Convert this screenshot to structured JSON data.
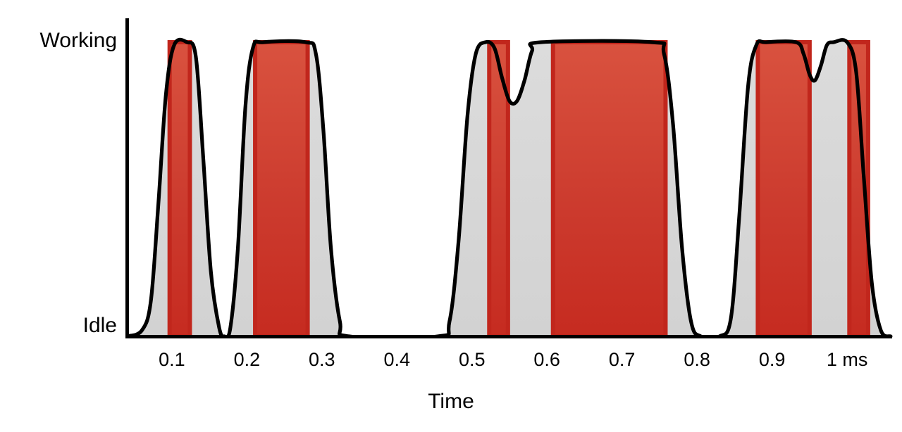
{
  "chart_data": {
    "type": "area",
    "title": "",
    "xlabel": "Time",
    "ylabel": "",
    "x_tick_labels": [
      "0.1",
      "0.2",
      "0.3",
      "0.4",
      "0.5",
      "0.6",
      "0.7",
      "0.8",
      "0.9",
      "1 ms"
    ],
    "x_tick_values": [
      0.1,
      0.2,
      0.3,
      0.4,
      0.5,
      0.6,
      0.7,
      0.8,
      0.9,
      1.0
    ],
    "xlim": [
      0.04,
      1.06
    ],
    "y_tick_labels": [
      "Working",
      "Idle"
    ],
    "y_tick_values": [
      1,
      0
    ],
    "ylim": [
      0,
      1
    ],
    "grid": false,
    "legend": null,
    "axis_lines": [
      "left",
      "bottom"
    ],
    "series": [
      {
        "name": "activity-envelope",
        "role": "smooth-envelope-curve",
        "fill_color": "#D6D6D6",
        "line_color": "#000000",
        "description": "Smooth envelope of processor activity rising from Idle to Working across five bursts",
        "points": [
          {
            "t": 0.04,
            "v": 0.0
          },
          {
            "t": 0.06,
            "v": 0.02
          },
          {
            "t": 0.072,
            "v": 0.12
          },
          {
            "t": 0.082,
            "v": 0.45
          },
          {
            "t": 0.092,
            "v": 0.82
          },
          {
            "t": 0.103,
            "v": 0.99
          },
          {
            "t": 0.12,
            "v": 1.0
          },
          {
            "t": 0.132,
            "v": 0.95
          },
          {
            "t": 0.142,
            "v": 0.6
          },
          {
            "t": 0.152,
            "v": 0.22
          },
          {
            "t": 0.163,
            "v": 0.03
          },
          {
            "t": 0.17,
            "v": 0.0
          },
          {
            "t": 0.178,
            "v": 0.03
          },
          {
            "t": 0.188,
            "v": 0.3
          },
          {
            "t": 0.198,
            "v": 0.78
          },
          {
            "t": 0.208,
            "v": 0.98
          },
          {
            "t": 0.222,
            "v": 1.0
          },
          {
            "t": 0.278,
            "v": 1.0
          },
          {
            "t": 0.292,
            "v": 0.96
          },
          {
            "t": 0.302,
            "v": 0.7
          },
          {
            "t": 0.312,
            "v": 0.3
          },
          {
            "t": 0.324,
            "v": 0.05
          },
          {
            "t": 0.336,
            "v": 0.0
          },
          {
            "t": 0.455,
            "v": 0.0
          },
          {
            "t": 0.47,
            "v": 0.05
          },
          {
            "t": 0.482,
            "v": 0.32
          },
          {
            "t": 0.494,
            "v": 0.75
          },
          {
            "t": 0.505,
            "v": 0.96
          },
          {
            "t": 0.518,
            "v": 1.0
          },
          {
            "t": 0.53,
            "v": 0.98
          },
          {
            "t": 0.54,
            "v": 0.88
          },
          {
            "t": 0.55,
            "v": 0.8
          },
          {
            "t": 0.56,
            "v": 0.8
          },
          {
            "t": 0.57,
            "v": 0.87
          },
          {
            "t": 0.58,
            "v": 0.97
          },
          {
            "t": 0.592,
            "v": 1.0
          },
          {
            "t": 0.74,
            "v": 1.0
          },
          {
            "t": 0.756,
            "v": 0.96
          },
          {
            "t": 0.768,
            "v": 0.72
          },
          {
            "t": 0.78,
            "v": 0.3
          },
          {
            "t": 0.792,
            "v": 0.05
          },
          {
            "t": 0.805,
            "v": 0.0
          },
          {
            "t": 0.83,
            "v": 0.0
          },
          {
            "t": 0.845,
            "v": 0.06
          },
          {
            "t": 0.856,
            "v": 0.4
          },
          {
            "t": 0.868,
            "v": 0.85
          },
          {
            "t": 0.879,
            "v": 0.99
          },
          {
            "t": 0.892,
            "v": 1.0
          },
          {
            "t": 0.932,
            "v": 1.0
          },
          {
            "t": 0.942,
            "v": 0.96
          },
          {
            "t": 0.95,
            "v": 0.89
          },
          {
            "t": 0.957,
            "v": 0.87
          },
          {
            "t": 0.965,
            "v": 0.92
          },
          {
            "t": 0.973,
            "v": 0.99
          },
          {
            "t": 0.982,
            "v": 1.0
          },
          {
            "t": 1.0,
            "v": 1.0
          },
          {
            "t": 1.012,
            "v": 0.9
          },
          {
            "t": 1.022,
            "v": 0.55
          },
          {
            "t": 1.033,
            "v": 0.18
          },
          {
            "t": 1.045,
            "v": 0.02
          },
          {
            "t": 1.058,
            "v": 0.0
          }
        ]
      }
    ],
    "bars": {
      "name": "active-intervals",
      "role": "red-highlight-bands",
      "fill_color": "#CC3B2E",
      "edge_color": "#C1261C",
      "value": 1.0,
      "intervals": [
        {
          "start": 0.097,
          "end": 0.124
        },
        {
          "start": 0.211,
          "end": 0.281
        },
        {
          "start": 0.523,
          "end": 0.548
        },
        {
          "start": 0.608,
          "end": 0.758
        },
        {
          "start": 0.881,
          "end": 0.95
        },
        {
          "start": 1.003,
          "end": 1.028
        }
      ]
    },
    "colors": {
      "envelope_fill": "#D6D6D6",
      "envelope_stroke": "#000000",
      "bar_fill": "#CC3B2E",
      "bar_edge": "#C1261C",
      "axis": "#000000",
      "background": "#FFFFFF",
      "text": "#000000"
    }
  },
  "axes": {
    "y": {
      "top_label": "Working",
      "bottom_label": "Idle"
    },
    "x": {
      "title": "Time",
      "ticks": [
        "0.1",
        "0.2",
        "0.3",
        "0.4",
        "0.5",
        "0.6",
        "0.7",
        "0.8",
        "0.9",
        "1 ms"
      ]
    }
  }
}
